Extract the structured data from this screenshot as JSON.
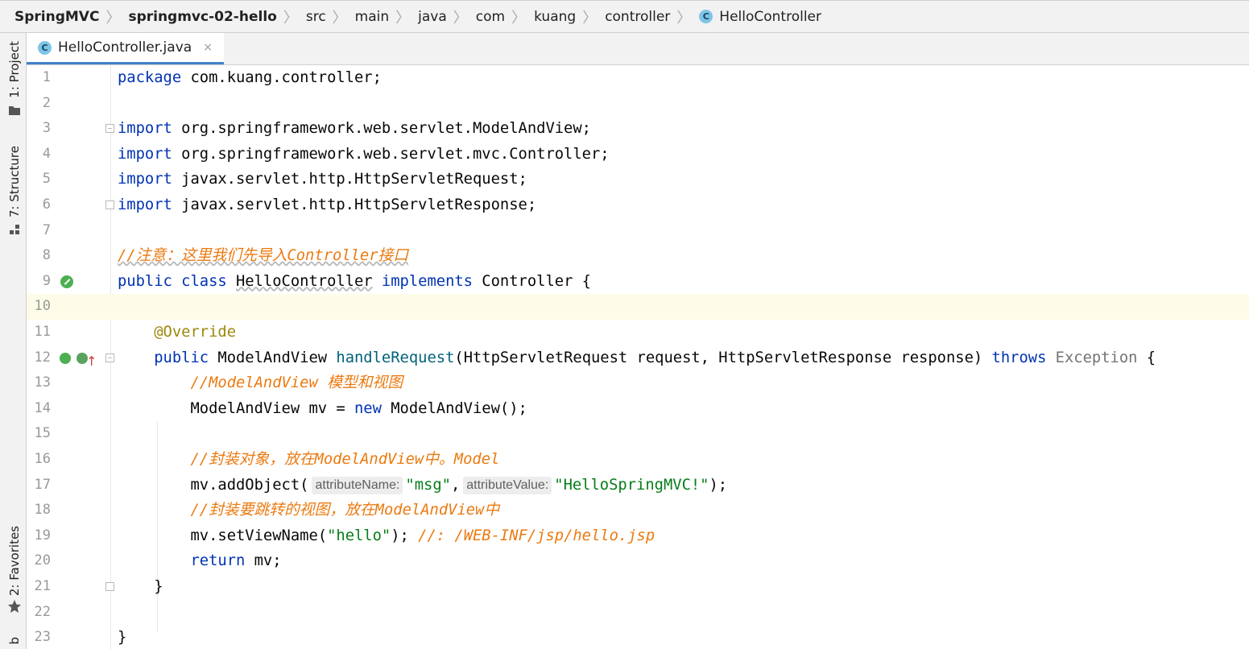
{
  "breadcrumb": {
    "items": [
      "SpringMVC",
      "springmvc-02-hello",
      "src",
      "main",
      "java",
      "com",
      "kuang",
      "controller",
      "HelloController"
    ]
  },
  "sidebar": {
    "project_label": "1: Project",
    "structure_label": "7: Structure",
    "favorites_label": "2: Favorites",
    "bottom_label": "b"
  },
  "tab": {
    "label": "HelloController.java",
    "close": "×",
    "icon_letter": "C"
  },
  "editor": {
    "current_line": 10,
    "line_numbers": [
      "1",
      "2",
      "3",
      "4",
      "5",
      "6",
      "7",
      "8",
      "9",
      "10",
      "11",
      "12",
      "13",
      "14",
      "15",
      "16",
      "17",
      "18",
      "19",
      "20",
      "21",
      "22",
      "23"
    ],
    "colors": {
      "keyword": "#0033b3",
      "string": "#067d17",
      "comment": "#eb7a10",
      "annotation": "#9e880d"
    },
    "tokens": {
      "l1_kw": "package",
      "l1_rest": " com.kuang.controller;",
      "l3_kw": "import",
      "l3_rest": " org.springframework.web.servlet.ModelAndView;",
      "l4_kw": "import",
      "l4_rest": " org.springframework.web.servlet.mvc.Controller;",
      "l5_kw": "import",
      "l5_rest": " javax.servlet.http.HttpServletRequest;",
      "l6_kw": "import",
      "l6_rest": " javax.servlet.http.HttpServletResponse;",
      "l8_cmt": "//注意：这里我们先导入Controller接口",
      "l9_kw1": "public class",
      "l9_name": "HelloController",
      "l9_kw2": "implements",
      "l9_rest": " Controller {",
      "l11_ann": "@Override",
      "l12_kw1": "public",
      "l12_type": " ModelAndView ",
      "l12_fn": "handleRequest",
      "l12_params": "(HttpServletRequest request, HttpServletResponse response) ",
      "l12_kw2": "throws",
      "l12_exc": " Exception",
      "l12_end": " {",
      "l13_cmt": "//ModelAndView 模型和视图",
      "l14_a": "ModelAndView mv = ",
      "l14_kw": "new",
      "l14_b": " ModelAndView();",
      "l16_cmt": "//封装对象，放在ModelAndView中。Model",
      "l17_a": "mv.addObject(",
      "l17_hint1": "attributeName:",
      "l17_str1": "\"msg\"",
      "l17_comma": ",",
      "l17_hint2": "attributeValue:",
      "l17_str2": "\"HelloSpringMVC!\"",
      "l17_end": ");",
      "l18_cmt": "//封装要跳转的视图，放在ModelAndView中",
      "l19_a": "mv.setViewName(",
      "l19_str": "\"hello\"",
      "l19_b": "); ",
      "l19_cmt": "//: /WEB-INF/jsp/hello.jsp",
      "l20_kw": "return",
      "l20_rest": " mv;",
      "l21_brace": "}",
      "l23_brace": "}"
    }
  },
  "gutter_icons": {
    "line9": "run-class-icon",
    "line12": "implements-method-icon"
  }
}
